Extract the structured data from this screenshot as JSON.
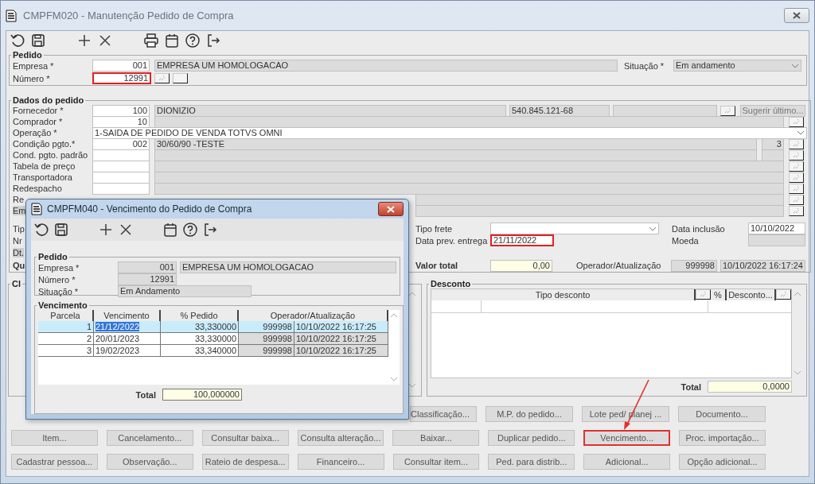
{
  "window": {
    "title": "CMPFM020 - Manutenção Pedido de Compra"
  },
  "pedido": {
    "title": "Pedido",
    "empresa_label": "Empresa *",
    "empresa_code": "001",
    "empresa_name": "EMPRESA UM HOMOLOGACAO",
    "numero_label": "Número *",
    "numero": "12991",
    "numero_highlighted": true,
    "situacao_label": "Situação *",
    "situacao": "Em andamento"
  },
  "dados": {
    "title": "Dados do pedido",
    "fornecedor": {
      "label": "Fornecedor *",
      "code": "100",
      "name": "DIONIZIO",
      "document": "540.845.121-68",
      "suggest_button": "Sugerir último..."
    },
    "rows": [
      {
        "kind": "lookup",
        "label": "Comprador *",
        "code": "10"
      },
      {
        "kind": "select",
        "label": "Operação *",
        "value": "1-SAIDA DE PEDIDO DE VENDA TOTVS OMNI"
      },
      {
        "kind": "lookup_short",
        "label": "Condição pgto.*",
        "code": "002",
        "name": "30/60/90 -TESTE",
        "extra": "3"
      },
      {
        "kind": "lookup_short",
        "label": "Cond. pgto. padrão"
      },
      {
        "kind": "lookup",
        "label": "Tabela de preço"
      },
      {
        "kind": "lookup",
        "label": "Transportadora"
      },
      {
        "kind": "lookup",
        "label": "Redespacho"
      },
      {
        "kind": "covered",
        "label": "Re"
      },
      {
        "kind": "covered",
        "label": "Em",
        "shaded": true
      }
    ],
    "lower_labels": [
      {
        "text": "Tip",
        "shaded": false,
        "kind": "plain"
      },
      {
        "text": "Nr",
        "shaded": false,
        "kind": "plain"
      },
      {
        "text": "Dt.",
        "shaded": true,
        "kind": "plain"
      },
      {
        "text": "Qu",
        "shaded": false,
        "kind": "total"
      }
    ],
    "tipo_frete": {
      "label": "Tipo frete"
    },
    "data_prev": {
      "label": "Data prev. entrega",
      "value": "21/11/2022",
      "highlighted": true
    },
    "data_inclusao": {
      "label": "Data inclusão",
      "value": "10/10/2022"
    },
    "moeda": {
      "label": "Moeda"
    },
    "valor_total": {
      "label": "Valor total",
      "value": "0,00"
    },
    "operador": {
      "label": "Operador/Atualização",
      "code": "999998",
      "timestamp": "10/10/2022 16:17:24"
    }
  },
  "left_panel": {
    "title": "Cl"
  },
  "desconto": {
    "title": "Desconto",
    "columns": [
      "Tipo desconto",
      "%",
      "Desconto..."
    ],
    "total_label": "Total",
    "total": "0,0000"
  },
  "button_rows": [
    [
      {
        "label": "Classificação...",
        "highlighted": false,
        "kind": "covered"
      },
      {
        "label": "M.P. do pedido...",
        "highlighted": false
      },
      {
        "label": "Lote ped/ planej ...",
        "highlighted": false
      },
      {
        "label": "Documento...",
        "highlighted": false
      }
    ],
    [
      {
        "label": "Item...",
        "highlighted": false
      },
      {
        "label": "Cancelamento...",
        "highlighted": false
      },
      {
        "label": "Consultar baixa...",
        "highlighted": false
      },
      {
        "label": "Consulta alteração...",
        "highlighted": false
      },
      {
        "label": "Baixar...",
        "highlighted": false
      },
      {
        "label": "Duplicar pedido...",
        "highlighted": false
      },
      {
        "label": "Vencimento...",
        "highlighted": true
      },
      {
        "label": "Proc. importação...",
        "highlighted": false
      }
    ],
    [
      {
        "label": "Cadastrar pessoa...",
        "highlighted": false
      },
      {
        "label": "Observação...",
        "highlighted": false
      },
      {
        "label": "Rateio de despesa...",
        "highlighted": false
      },
      {
        "label": "Financeiro...",
        "highlighted": false
      },
      {
        "label": "Consultar item...",
        "highlighted": false
      },
      {
        "label": "Ped. para distrib...",
        "highlighted": false
      },
      {
        "label": "Adicional...",
        "highlighted": false
      },
      {
        "label": "Opção adicional...",
        "highlighted": false
      }
    ]
  ],
  "dialog": {
    "title": "CMPFM040 - Vencimento do Pedido de Compra",
    "pedido": {
      "title": "Pedido",
      "empresa_label": "Empresa *",
      "empresa_code": "001",
      "empresa_name": "EMPRESA UM HOMOLOGACAO",
      "numero_label": "Número *",
      "numero": "12991",
      "situacao_label": "Situação *",
      "situacao": "Em Andamento"
    },
    "vencimento": {
      "title": "Vencimento",
      "columns": [
        "Parcela",
        "Vencimento",
        "% Pedido",
        "Operador/Atualização"
      ],
      "rows": [
        {
          "parcela": "1",
          "vencimento": "21/12/2022",
          "percent": "33,330000",
          "operador": "999998",
          "atualizacao": "10/10/2022 16:17:25",
          "selected": true
        },
        {
          "parcela": "2",
          "vencimento": "20/01/2023",
          "percent": "33,330000",
          "operador": "999998",
          "atualizacao": "10/10/2022 16:17:25",
          "selected": false
        },
        {
          "parcela": "3",
          "vencimento": "19/02/2023",
          "percent": "33,340000",
          "operador": "999998",
          "atualizacao": "10/10/2022 16:17:25",
          "selected": false
        }
      ],
      "total_label": "Total",
      "total": "100,000000"
    }
  }
}
